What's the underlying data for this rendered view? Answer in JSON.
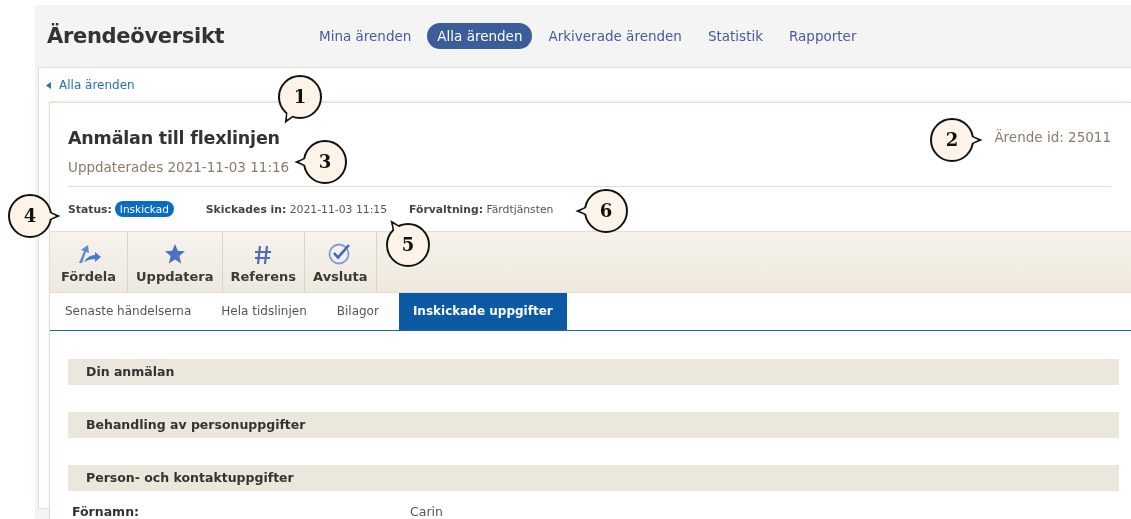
{
  "header": {
    "title": "Ärendeöversikt"
  },
  "nav": [
    {
      "label": "Mina ärenden",
      "selected": false
    },
    {
      "label": "Alla ärenden",
      "selected": true
    },
    {
      "label": "Arkiverade ärenden",
      "selected": false
    },
    {
      "label": "Statistik",
      "selected": false
    },
    {
      "label": "Rapporter",
      "selected": false
    }
  ],
  "breadcrumb": {
    "label": "Alla ärenden"
  },
  "case": {
    "title": "Anmälan till flexlinjen",
    "updated": "Uppdaterades 2021-11-03 11:16",
    "case_id": "Ärende id: 25011",
    "status_label": "Status:",
    "status": "Inskickad",
    "submitted": "**Skickades in:** 2021-11-03 11:15",
    "department": "**Förvaltning:** Färdtjänsten"
  },
  "actions": [
    {
      "label": "Fördela"
    },
    {
      "label": "Uppdatera"
    },
    {
      "label": "Referens"
    },
    {
      "label": "Avsluta"
    }
  ],
  "tabs": [
    {
      "label": "Senaste händelserna",
      "selected": false
    },
    {
      "label": "Hela tidslinjen",
      "selected": false
    },
    {
      "label": "Bilagor",
      "selected": false
    },
    {
      "label": "Inskickade uppgifter",
      "selected": true
    }
  ],
  "sections": [
    {
      "title": "Din anmälan"
    },
    {
      "title": "Behandling av personuppgifter"
    },
    {
      "title": "Person- och kontaktuppgifter"
    }
  ],
  "fields": [
    {
      "label": "Förnamn:",
      "value": "Carin"
    }
  ],
  "callouts": [
    {
      "label": "1"
    },
    {
      "label": "2"
    },
    {
      "label": "3"
    },
    {
      "label": "4"
    },
    {
      "label": "5"
    },
    {
      "label": "6"
    }
  ]
}
